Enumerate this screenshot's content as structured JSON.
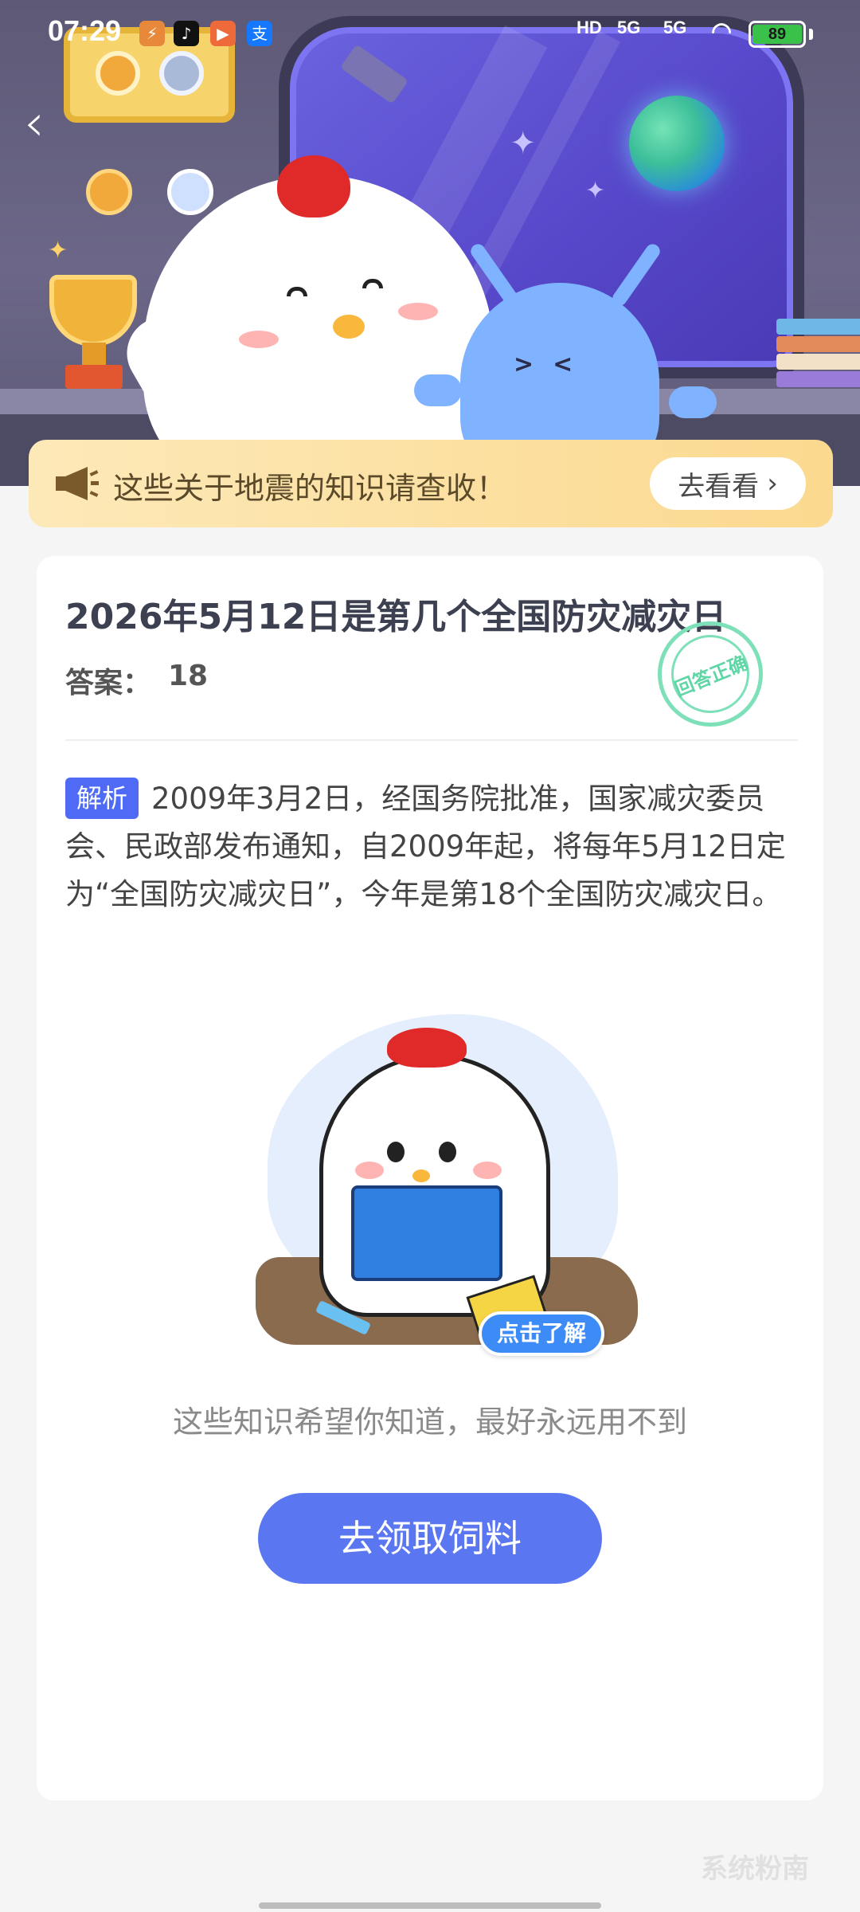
{
  "status_bar": {
    "time": "07:29",
    "network_hd": "HD",
    "signal_1": "5G",
    "signal_2": "5G",
    "battery": "89"
  },
  "notice": {
    "text": "这些关于地震的知识请查收！",
    "button_label": "去看看",
    "button_chevron": "›"
  },
  "question": {
    "title": "2026年5月12日是第几个全国防灾减灾日",
    "answer_label": "答案：",
    "answer_value": "18",
    "stamp_text": "回答正确"
  },
  "analysis": {
    "tag": "解析",
    "text": "2009年3月2日，经国务院批准，国家减灾委员会、民政部发布通知，自2009年起，将每年5月12日定为“全国防灾减灾日”，今年是第18个全国防灾减灾日。"
  },
  "illustration": {
    "learn_more_label": "点击了解"
  },
  "hint": "这些知识希望你知道，最好永远用不到",
  "cta_label": "去领取饲料",
  "watermark": "系统粉南",
  "colors": {
    "accent": "#5a77f1",
    "tag": "#4f6bf5",
    "stamp": "#7ee0b8"
  }
}
